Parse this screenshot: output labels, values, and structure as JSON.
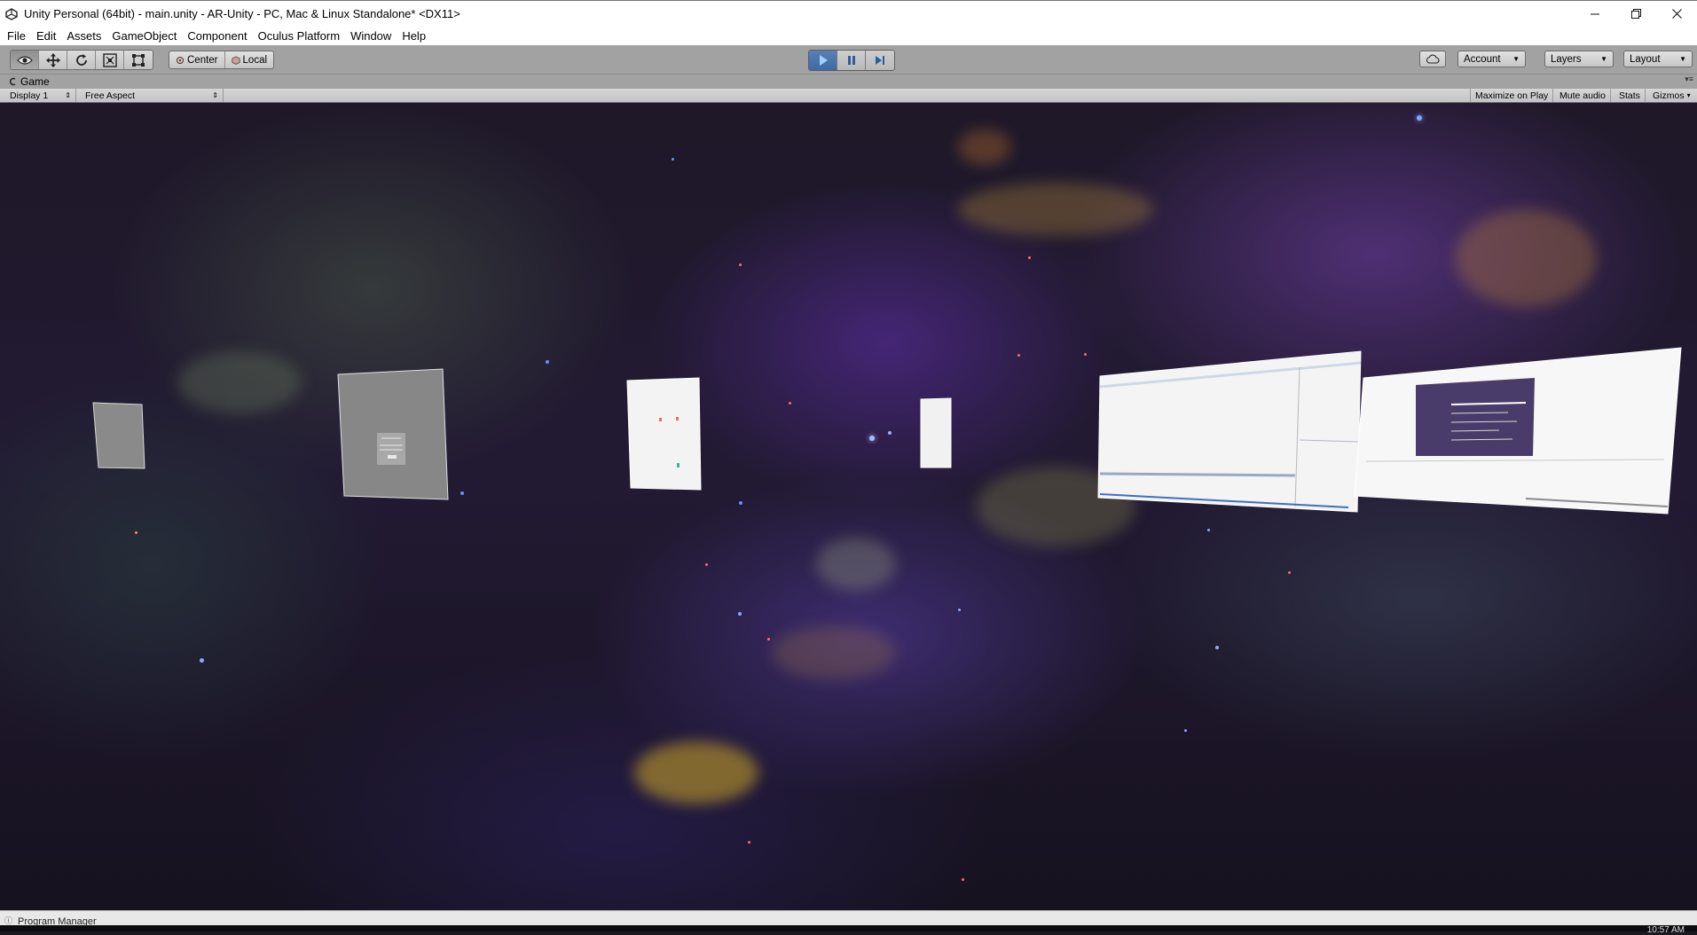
{
  "window": {
    "title": "Unity Personal (64bit) - main.unity - AR-Unity - PC, Mac & Linux Standalone* <DX11>",
    "controls": [
      "minimize",
      "restore",
      "close"
    ]
  },
  "menu": {
    "items": [
      "File",
      "Edit",
      "Assets",
      "GameObject",
      "Component",
      "Oculus Platform",
      "Window",
      "Help"
    ]
  },
  "toolbar": {
    "tools": [
      "hand-icon",
      "move-icon",
      "rotate-icon",
      "scale-icon",
      "rect-icon"
    ],
    "pivot_label": "Center",
    "space_label": "Local",
    "playback": {
      "playing": true
    },
    "account_label": "Account",
    "layers_label": "Layers",
    "layout_label": "Layout"
  },
  "game_tab": {
    "label": "Game",
    "display": "Display 1",
    "aspect": "Free Aspect",
    "maximize_on_play": "Maximize on Play",
    "mute_audio": "Mute audio",
    "stats": "Stats",
    "gizmos": "Gizmos"
  },
  "taskbar": {
    "window_label": "Program Manager",
    "clock": "10:57 AM"
  },
  "colors": {
    "toolbar_bg": "#a2a2a2",
    "play_active": "#3f6aa5",
    "space_bg": "#1e1828"
  }
}
